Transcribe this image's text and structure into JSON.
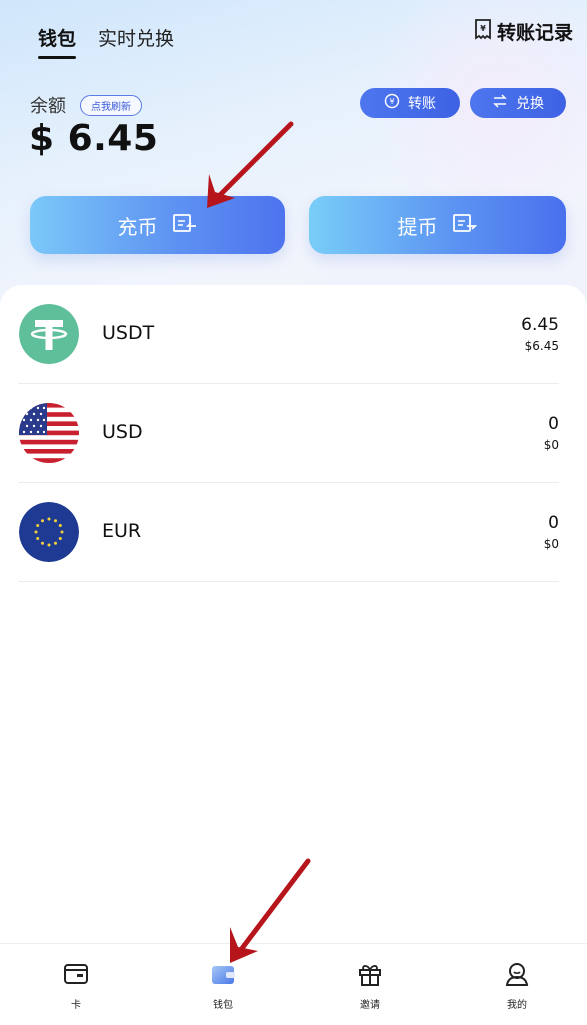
{
  "header": {
    "tabs": [
      {
        "label": "钱包",
        "active": true
      },
      {
        "label": "实时兑换",
        "active": false
      }
    ],
    "records_label": "转账记录",
    "records_icon": "receipt-icon"
  },
  "balance": {
    "label": "余额",
    "refresh_label": "点我刷新",
    "amount": "$ 6.45"
  },
  "actions": {
    "transfer_label": "转账",
    "exchange_label": "兑换",
    "deposit_label": "充币",
    "withdraw_label": "提币"
  },
  "assets": [
    {
      "name": "USDT",
      "qty": "6.45",
      "fiat": "$6.45",
      "icon": "tether-icon"
    },
    {
      "name": "USD",
      "qty": "0",
      "fiat": "$0",
      "icon": "us-flag-icon"
    },
    {
      "name": "EUR",
      "qty": "0",
      "fiat": "$0",
      "icon": "eu-flag-icon"
    }
  ],
  "nav": [
    {
      "label": "卡",
      "icon": "card-icon"
    },
    {
      "label": "钱包",
      "icon": "wallet-icon",
      "active": true
    },
    {
      "label": "邀请",
      "icon": "gift-icon"
    },
    {
      "label": "我的",
      "icon": "profile-icon"
    }
  ],
  "colors": {
    "accent": "#4568e6",
    "tether": "#5fbf9a",
    "eu_blue": "#1f3a93",
    "annotation_arrow": "#b5151b"
  }
}
